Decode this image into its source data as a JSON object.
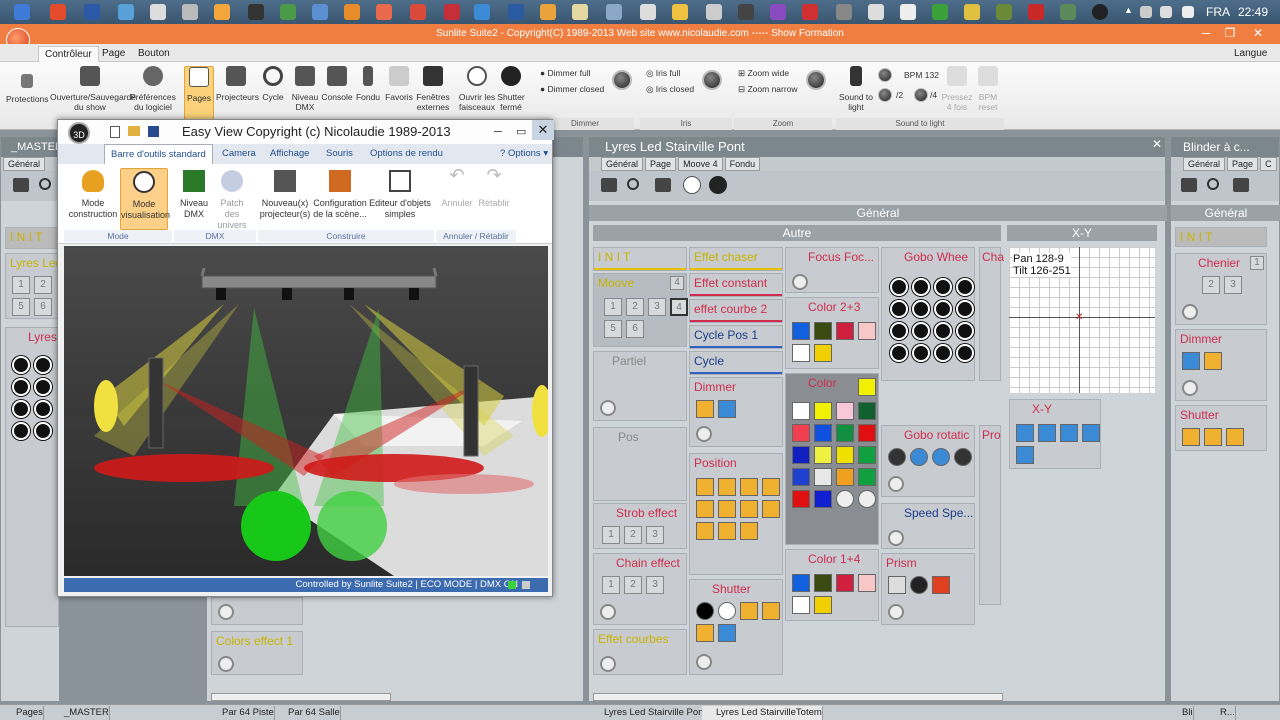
{
  "taskbar": {
    "language": "FRA",
    "clock": "22:49"
  },
  "app": {
    "title": "Sunlite Suite2 - Copyright(C) 1989-2013      Web site www.nicolaudie.com ----- Show Formation",
    "langue": "Langue"
  },
  "ribbon_tabs": [
    "Contrôleur",
    "Page",
    "Bouton"
  ],
  "ribbon": {
    "protections": "Protections",
    "ouverture": "Ouverture/Sauvegarde du show",
    "preferences": "Préférences du logiciel",
    "pages": "Pages",
    "projecteurs": "Projecteurs",
    "cycle": "Cycle",
    "niveau_dmx": "Niveau DMX",
    "console": "Console",
    "fondu": "Fondu",
    "favoris": "Favoris",
    "fenetres": "Fenêtres externes",
    "ouvrir": "Ouvrir les faisceaux",
    "shutter": "Shutter fermé",
    "dimmer_full": "Dimmer full",
    "dimmer_closed": "Dimmer closed",
    "iris_full": "Iris full",
    "iris_closed": "Iris closed",
    "zoom_wide": "Zoom wide",
    "zoom_narrow": "Zoom narrow",
    "sound": "Sound to light",
    "bpm": "BPM 132",
    "div2": "/2",
    "div4": "/4",
    "pressez": "Pressez 4 fois",
    "bpm_reset": "BPM reset",
    "group_dimmer": "Dimmer",
    "group_iris": "Iris",
    "group_zoom": "Zoom",
    "group_sound": "Sound to light"
  },
  "easyview": {
    "title": "Easy View   Copyright (c) Nicolaudie 1989-2013",
    "tabs": [
      "Barre d'outils standard",
      "Camera",
      "Affichage",
      "Souris",
      "Options de rendu"
    ],
    "options": "Options",
    "buttons": {
      "mode_construction": "Mode construction",
      "mode_visualisation": "Mode visualisation",
      "niveau_dmx": "Niveau DMX",
      "patch": "Patch des univers",
      "nouveau": "Nouveau(x) projecteur(s)",
      "config": "Configuration de la scène...",
      "editeur": "Editeur d'objets simples",
      "annuler": "Annuler",
      "retablir": "Rétablir"
    },
    "groups": [
      "Mode",
      "DMX",
      "Construire",
      "Annuler / Rétablir"
    ],
    "status": "Controlled by Sunlite Suite2  |  ECO MODE  |  DMX ON"
  },
  "left_pane": {
    "title": "_MASTER",
    "tab": "Général",
    "init": "I N I T",
    "lyres_led": "Lyres Led",
    "lyres": "Lyres",
    "colors_effect": "Colors effect 1"
  },
  "main_pane": {
    "title": "Lyres Led Stairville Pont",
    "subtabs": [
      "Général",
      "Page",
      "Moove 4",
      "Fondu"
    ],
    "section_general": "Général",
    "section_autre": "Autre",
    "section_xy": "X-Y",
    "xy_readout": [
      "Pan 128-9",
      "Tilt 126-251"
    ],
    "xy_label": "X-Y",
    "col1": {
      "init": "I N I T",
      "moove": "Moove",
      "moove_badge": "4",
      "partiel": "Partiel",
      "pos": "Pos",
      "strob": "Strob effect",
      "chain": "Chain effect",
      "effet_courbes": "Effet courbes"
    },
    "col2": {
      "effet_chaser": "Effet chaser",
      "effet_constant": "Effet constant",
      "effet_courbe2": "effet courbe 2",
      "cycle_pos": "Cycle Pos 1",
      "cycle": "Cycle",
      "dimmer": "Dimmer",
      "position": "Position",
      "shutter": "Shutter"
    },
    "col3": {
      "focus": "Focus Foc...",
      "color23": "Color 2+3",
      "color": "Color",
      "color14": "Color 1+4"
    },
    "col4": {
      "gobo_wheel": "Gobo Whee",
      "gobo_rotation": "Gobo rotatic",
      "speed": "Speed Spe...",
      "prism": "Prism"
    },
    "col5": {
      "cha": "Cha",
      "pro": "Pro"
    }
  },
  "right_pane": {
    "title": "Blinder à c...",
    "subtabs": [
      "Général",
      "Page",
      "C"
    ],
    "section": "Général",
    "init": "I N I T",
    "chenier": "Chenier",
    "chenier_badge": "1",
    "dimmer": "Dimmer",
    "shutter": "Shutter"
  },
  "bottombar": [
    "Pages",
    "_MASTER",
    "Par 64 Piste",
    "Par 64 Salle",
    "Lyres Led Stairville Pont",
    "Lyres Led StairvilleTotem",
    "Bli",
    "R..."
  ],
  "colors": {
    "accent": "#f07e40",
    "label_red": "#d02d4e",
    "label_yellow": "#c8b400"
  }
}
